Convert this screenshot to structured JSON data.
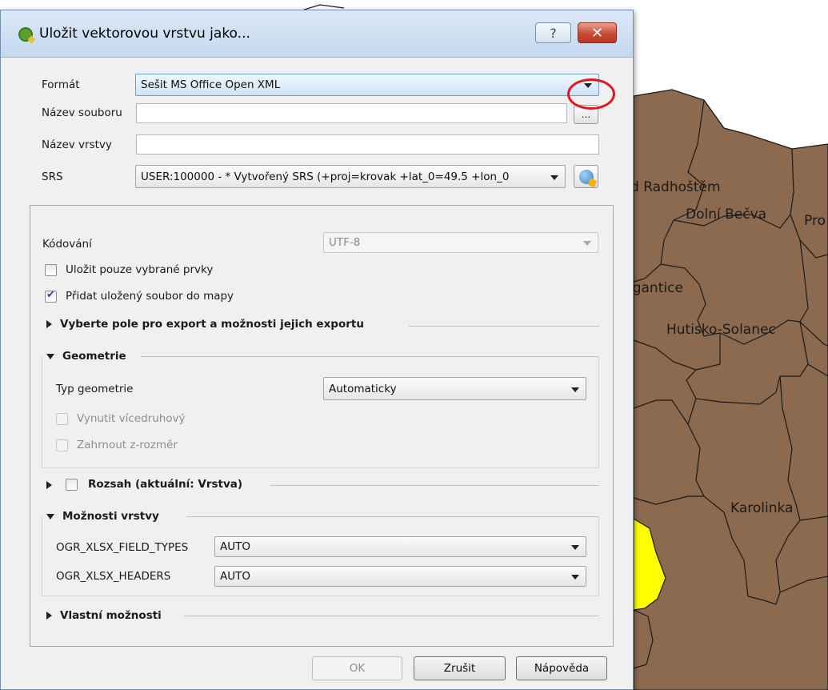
{
  "window": {
    "title": "Uložit vektorovou vrstvu jako...",
    "help_glyph": "?",
    "close_glyph": "✕"
  },
  "form": {
    "format_label": "Formát",
    "format_value": "Sešit MS Office Open XML",
    "filename_label": "Název souboru",
    "filename_value": "",
    "browse_label": "...",
    "layername_label": "Název vrstvy",
    "layername_value": "",
    "srs_label": "SRS",
    "srs_value": "USER:100000 -  * Vytvořený SRS (+proj=krovak +lat_0=49.5 +lon_0"
  },
  "options": {
    "encoding_label": "Kódování",
    "encoding_value": "UTF-8",
    "save_selected_label": "Uložit pouze vybrané prvky",
    "save_selected_checked": false,
    "add_to_map_label": "Přidat uložený soubor do mapy",
    "add_to_map_checked": true
  },
  "sections": {
    "fields": "Vyberte pole pro export a možnosti jejich exportu",
    "geometry": "Geometrie",
    "extent": "Rozsah (aktuální: Vrstva)",
    "layer_options": "Možnosti vrstvy",
    "custom_options": "Vlastní možnosti"
  },
  "geometry": {
    "type_label": "Typ geometrie",
    "type_value": "Automaticky",
    "force_multi_label": "Vynutit vícedruhový",
    "include_z_label": "Zahrnout z-rozměr"
  },
  "layer_options": {
    "field_types_label": "OGR_XLSX_FIELD_TYPES",
    "field_types_value": "AUTO",
    "headers_label": "OGR_XLSX_HEADERS",
    "headers_value": "AUTO"
  },
  "buttons": {
    "ok": "OK",
    "cancel": "Zrušit",
    "help": "Nápověda"
  },
  "map": {
    "fill_color": "#8b6a50",
    "highlight_color": "#ffff00",
    "labels": [
      "d Radhoštěm",
      "Dolní Bečva",
      "Pro",
      "igantice",
      "Hutisko-Solanec",
      "Karolinka"
    ]
  },
  "annotation": {
    "color": "#e8141c"
  }
}
